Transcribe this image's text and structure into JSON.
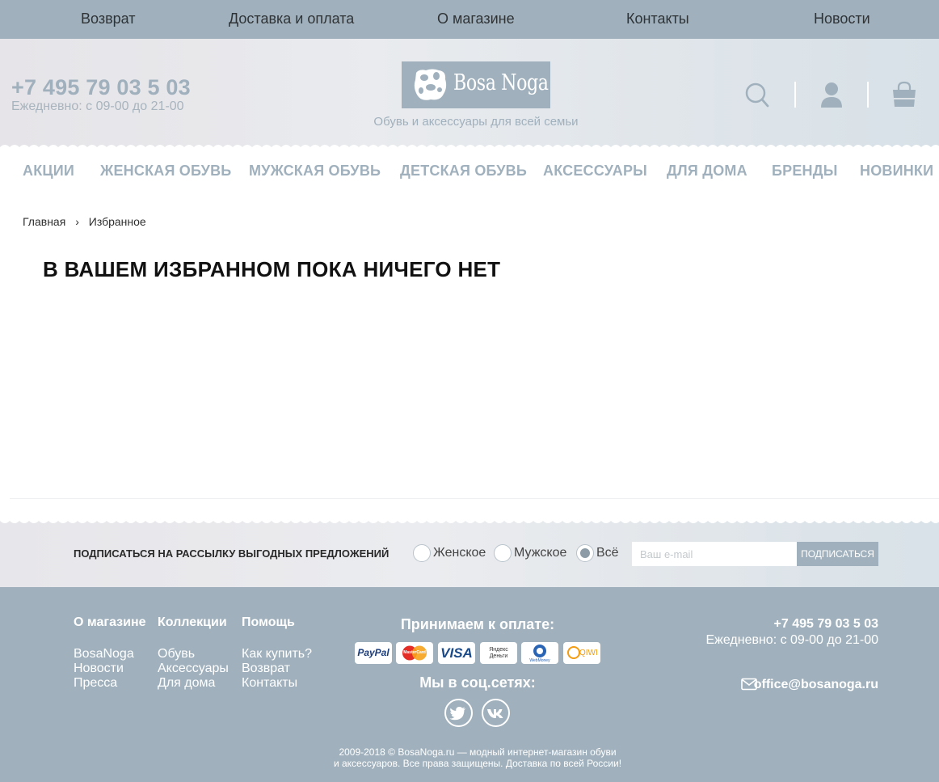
{
  "top_nav": [
    "Возврат",
    "Доставка и оплата",
    "О магазине",
    "Контакты",
    "Новости"
  ],
  "header": {
    "phone": "+7 495 79 03 5 03",
    "hours": "Ежедневно: с 09-00 до 21-00",
    "logo": "Bosa Noga",
    "tagline": "Обувь и аксессуары для всей семьи",
    "icons": [
      "search-icon",
      "user-icon",
      "cart-icon"
    ]
  },
  "category_nav": [
    "АКЦИИ",
    "ЖЕНСКАЯ ОБУВЬ",
    "МУЖСКАЯ ОБУВЬ",
    "ДЕТСКАЯ ОБУВЬ",
    "АКСЕССУАРЫ",
    "ДЛЯ ДОМА",
    "БРЕНДЫ",
    "НОВИНКИ"
  ],
  "breadcrumb": {
    "home": "Главная",
    "separator": "›",
    "current": "Избранное"
  },
  "page": {
    "title": "В ВАШЕМ ИЗБРАННОМ ПОКА НИЧЕГО НЕТ"
  },
  "subscribe": {
    "label": "ПОДПИСАТЬСЯ НА РАССЫЛКУ ВЫГОДНЫХ ПРЕДЛОЖЕНИЙ",
    "options": [
      "Женское",
      "Мужское",
      "Всё"
    ],
    "selected": "Всё",
    "placeholder": "Ваш e-mail",
    "button": "ПОДПИСАТЬСЯ"
  },
  "footer": {
    "columns": [
      {
        "title": "О магазине",
        "links": [
          "BosaNoga",
          "Новости",
          "Пресса"
        ]
      },
      {
        "title": "Коллекции",
        "links": [
          "Обувь",
          "Аксессуары",
          "Для дома"
        ]
      },
      {
        "title": "Помощь",
        "links": [
          "Как купить?",
          "Возврат",
          "Контакты"
        ]
      }
    ],
    "payment_title": "Принимаем к оплате:",
    "payment_methods": [
      "PayPal",
      "MasterCard",
      "VISA",
      "Яндекс Деньги",
      "WebMoney",
      "QIWI"
    ],
    "social_title": "Мы в соц.сетях:",
    "social": [
      "twitter-icon",
      "vk-icon"
    ],
    "phone": "+7 495 79 03 5 03",
    "hours": "Ежедневно: с 09-00 до 21-00",
    "email": "office@bosanoga.ru",
    "copyright_line1": "2009-2018 © BosaNoga.ru — модный интернет-магазин обуви",
    "copyright_line2": "и аксессуаров. Все права защищены. Доставка по всей России!"
  },
  "colors": {
    "accent": "#a0b1bd",
    "text": "#2b2b2b",
    "white": "#ffffff"
  }
}
